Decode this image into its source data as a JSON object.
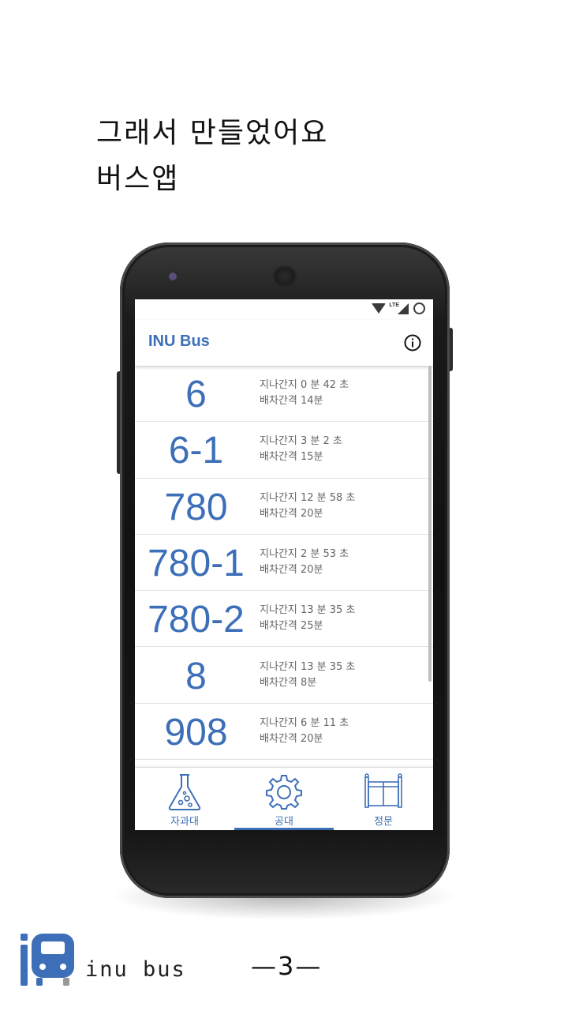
{
  "slide": {
    "headline_line1": "그래서 만들었어요",
    "headline_line2": "버스앱",
    "brand_name": "inu bus",
    "page_number": "—3—"
  },
  "app": {
    "title": "INU Bus",
    "accent_color": "#3d6fb8",
    "status_icons": [
      "wifi-icon",
      "lte-signal-icon",
      "battery-icon"
    ],
    "routes": [
      {
        "number": "6",
        "elapsed": "지나간지 0 분 42 초",
        "interval": "배차간격 14분"
      },
      {
        "number": "6-1",
        "elapsed": "지나간지 3 분 2 초",
        "interval": "배차간격 15분"
      },
      {
        "number": "780",
        "elapsed": "지나간지 12 분 58 초",
        "interval": "배차간격 20분"
      },
      {
        "number": "780-1",
        "elapsed": "지나간지 2 분 53 초",
        "interval": "배차간격 20분"
      },
      {
        "number": "780-2",
        "elapsed": "지나간지 13 분 35 초",
        "interval": "배차간격 25분"
      },
      {
        "number": "8",
        "elapsed": "지나간지 13 분 35 초",
        "interval": "배차간격 8분"
      },
      {
        "number": "908",
        "elapsed": "지나간지 6 분 11 초",
        "interval": "배차간격 20분"
      }
    ],
    "tabs": [
      {
        "label": "자과대",
        "icon": "flask-icon",
        "selected": false
      },
      {
        "label": "공대",
        "icon": "gear-icon",
        "selected": true
      },
      {
        "label": "정문",
        "icon": "gate-icon",
        "selected": false
      }
    ]
  }
}
